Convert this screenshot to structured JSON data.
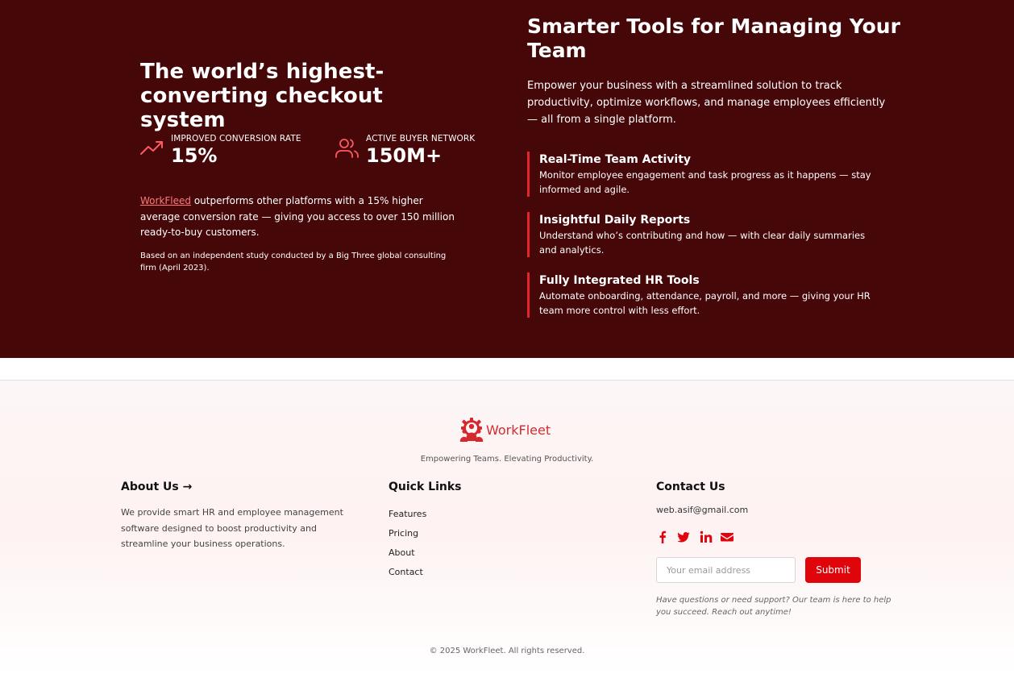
{
  "hero": {
    "left": {
      "title": "The world’s highest-converting checkout system",
      "stats": [
        {
          "icon": "trending-up-icon",
          "label": "Improved conversion rate",
          "value": "15%"
        },
        {
          "icon": "users-icon",
          "label": "Active buyer network",
          "value": "150M+"
        }
      ],
      "description_link": "WorkFleed",
      "description_rest": " outperforms other platforms with a 15% higher average conversion rate — giving you access to over 150 million ready-to-buy customers.",
      "note": "Based on an independent study conducted by a Big Three global consulting firm (April 2023)."
    },
    "right": {
      "title": "Smarter Tools for Managing Your Team",
      "lead": "Empower your business with a streamlined solution to track productivity, optimize workflows, and manage employees efficiently — all from a single platform.",
      "features": [
        {
          "title": "Real-Time Team Activity",
          "text": "Monitor employee engagement and task progress as it happens — stay informed and agile."
        },
        {
          "title": "Insightful Daily Reports",
          "text": "Understand who’s contributing and how — with clear daily summaries and analytics."
        },
        {
          "title": "Fully Integrated HR Tools",
          "text": "Automate onboarding, attendance, payroll, and more — giving your HR team more control with less effort."
        }
      ]
    }
  },
  "footer": {
    "brand": {
      "name": "WorkFleet",
      "icon": "team-gear-logo-icon",
      "tagline": "Empowering Teams. Elevating Productivity."
    },
    "about": {
      "heading": "About Us →",
      "text": "We provide smart HR and employee management software designed to boost productivity and streamline your business operations."
    },
    "quick_links": {
      "heading": "Quick Links",
      "items": [
        "Features",
        "Pricing",
        "About",
        "Contact"
      ]
    },
    "contact": {
      "heading": "Contact Us",
      "email": "web.asif@gmail.com",
      "socials": [
        "facebook-icon",
        "twitter-icon",
        "linkedin-icon",
        "envelope-icon"
      ],
      "input_placeholder": "Your email address",
      "submit_label": "Submit",
      "support_text": "Have questions or need support? Our team is here to help you succeed. Reach out anytime!"
    },
    "copyright": "© 2025 WorkFleet. All rights reserved."
  },
  "colors": {
    "hero_bg": "#460709",
    "accent": "#e0040b",
    "brand": "#d42a2f",
    "stat_icon": "#ff5a5f"
  }
}
